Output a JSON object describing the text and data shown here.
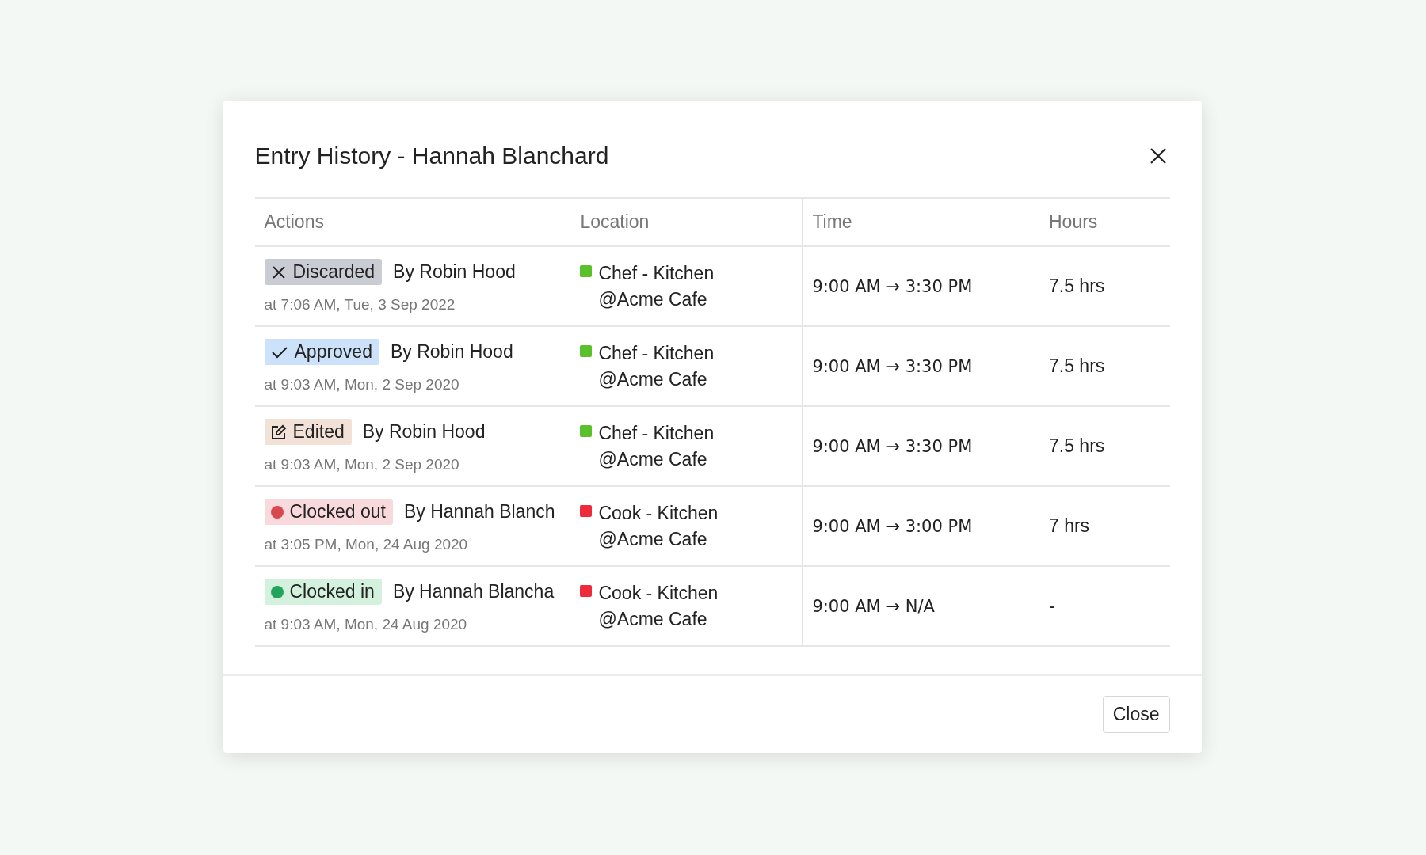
{
  "dialog": {
    "title": "Entry History - Hannah Blanchard"
  },
  "table": {
    "columns": [
      "Actions",
      "Location",
      "Time",
      "Hours"
    ],
    "rows": [
      {
        "action": {
          "kind": "discarded",
          "label": "Discarded"
        },
        "by": "By Robin Hood",
        "at": "at 7:06 AM, Tue, 3 Sep 2022",
        "location": {
          "color": "#5ac12a",
          "line1": "Chef - Kitchen",
          "line2": "@Acme Cafe"
        },
        "time": "9:00 AM → 3:30 PM",
        "hours": "7.5 hrs"
      },
      {
        "action": {
          "kind": "approved",
          "label": "Approved"
        },
        "by": "By Robin Hood",
        "at": "at 9:03 AM, Mon, 2 Sep 2020",
        "location": {
          "color": "#5ac12a",
          "line1": "Chef - Kitchen",
          "line2": "@Acme Cafe"
        },
        "time": "9:00 AM → 3:30 PM",
        "hours": "7.5 hrs"
      },
      {
        "action": {
          "kind": "edited",
          "label": "Edited"
        },
        "by": "By Robin Hood",
        "at": "at 9:03 AM, Mon, 2 Sep 2020",
        "location": {
          "color": "#5ac12a",
          "line1": "Chef - Kitchen",
          "line2": "@Acme Cafe"
        },
        "time": "9:00 AM → 3:30 PM",
        "hours": "7.5 hrs"
      },
      {
        "action": {
          "kind": "clocked_out",
          "label": "Clocked out"
        },
        "by": "By Hannah Blanch",
        "at": "at 3:05 PM, Mon, 24 Aug 2020",
        "location": {
          "color": "#ee2b3b",
          "line1": "Cook - Kitchen",
          "line2": "@Acme Cafe"
        },
        "time": "9:00 AM → 3:00 PM",
        "hours": "7 hrs"
      },
      {
        "action": {
          "kind": "clocked_in",
          "label": "Clocked in"
        },
        "by": "By Hannah Blancha",
        "at": "at 9:03 AM, Mon, 24 Aug 2020",
        "location": {
          "color": "#ee2b3b",
          "line1": "Cook - Kitchen",
          "line2": "@Acme Cafe"
        },
        "time": "9:00 AM → N/A",
        "hours": "-"
      }
    ]
  },
  "footer": {
    "button": "Close"
  }
}
